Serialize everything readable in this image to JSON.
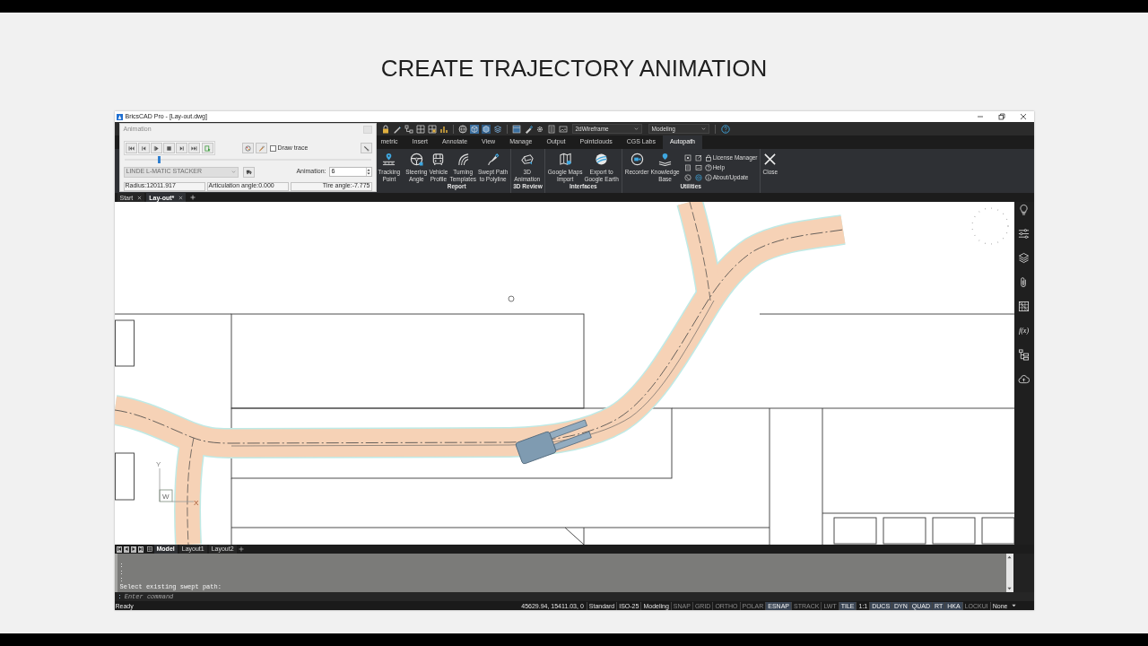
{
  "video_title": "CREATE TRAJECTORY ANIMATION",
  "window": {
    "title": "BricsCAD Pro - [Lay-out.dwg]"
  },
  "quick_access": {
    "visual_style": "2dWireframe",
    "workspace": "Modeling"
  },
  "ribbon_tabs": [
    {
      "label": "metric",
      "selected": false
    },
    {
      "label": "Insert",
      "selected": false
    },
    {
      "label": "Annotate",
      "selected": false
    },
    {
      "label": "View",
      "selected": false
    },
    {
      "label": "Manage",
      "selected": false
    },
    {
      "label": "Output",
      "selected": false
    },
    {
      "label": "Pointclouds",
      "selected": false
    },
    {
      "label": "CGS Labs",
      "selected": false
    },
    {
      "label": "Autopath",
      "selected": true
    }
  ],
  "ribbon": {
    "groups": [
      {
        "buttons": [
          {
            "label": "Tracking\nPoint"
          }
        ]
      },
      {
        "title": "Report",
        "buttons": [
          {
            "label": "Steering\nAngle"
          },
          {
            "label": "Vehicle\nProfile"
          },
          {
            "label": "Turning\nTemplates"
          },
          {
            "label": "Swept Path\nto Polyline"
          }
        ]
      },
      {
        "title": "3D Review",
        "buttons": [
          {
            "label": "3D\nAnimation"
          }
        ]
      },
      {
        "title": "Interfaces",
        "buttons": [
          {
            "label": "Google Maps\nImport"
          },
          {
            "label": "Export to\nGoogle Earth"
          }
        ]
      },
      {
        "title": "Utilities",
        "buttons": [
          {
            "label": "Recorder"
          },
          {
            "label": "Knowledge\nBase"
          }
        ],
        "links": [
          "License Manager",
          "Help",
          "About/Update"
        ]
      },
      {
        "buttons": [
          {
            "label": "Close"
          }
        ]
      }
    ]
  },
  "animation_panel": {
    "title": "Animation",
    "draw_trace": {
      "label": "Draw trace",
      "checked": false
    },
    "slider": {
      "level": 0.14
    },
    "vehicle": {
      "value": "LINDE L-MATIC STACKER",
      "disabled": true
    },
    "animation_count": {
      "label": "Animation:",
      "value": "6"
    },
    "readouts": [
      "Radius:12011.917",
      "Articulation angle:0.000",
      "Tire angle:-7.775"
    ]
  },
  "document_tabs": [
    {
      "label": "Start",
      "selected": false
    },
    {
      "label": "Lay-out*",
      "selected": true
    }
  ],
  "drawing": {
    "ucs_icon": {
      "y_axis": "Y",
      "origin": "W",
      "x_axis": "X"
    }
  },
  "sidebar": {
    "formula_label": "f(x)"
  },
  "layout_tabs": [
    {
      "label": "Model",
      "selected": true
    },
    {
      "label": "Layout1",
      "selected": false
    },
    {
      "label": "Layout2",
      "selected": false
    }
  ],
  "command_line": {
    "history": [
      ":",
      ":",
      ":",
      "Select existing swept path:"
    ],
    "prompt": ":",
    "placeholder": "Enter command"
  },
  "status_bar": {
    "state": "Ready",
    "coordinates": "45629.94, 15411.03, 0",
    "items": [
      {
        "label": "Standard",
        "kind": "text"
      },
      {
        "label": "ISO-25",
        "kind": "text"
      },
      {
        "label": "Modeling",
        "kind": "text"
      },
      {
        "label": "SNAP",
        "kind": "toggle",
        "on": false
      },
      {
        "label": "GRID",
        "kind": "toggle",
        "on": false
      },
      {
        "label": "ORTHO",
        "kind": "toggle",
        "on": false
      },
      {
        "label": "POLAR",
        "kind": "toggle",
        "on": false
      },
      {
        "label": "ESNAP",
        "kind": "toggle",
        "on": true
      },
      {
        "label": "STRACK",
        "kind": "toggle",
        "on": false
      },
      {
        "label": "LWT",
        "kind": "toggle",
        "on": false
      },
      {
        "label": "TILE",
        "kind": "toggle",
        "on": true
      },
      {
        "label": "1:1",
        "kind": "text"
      },
      {
        "label": "DUCS",
        "kind": "toggle",
        "on": true
      },
      {
        "label": "DYN",
        "kind": "toggle",
        "on": true
      },
      {
        "label": "QUAD",
        "kind": "toggle",
        "on": true
      },
      {
        "label": "RT",
        "kind": "toggle",
        "on": true
      },
      {
        "label": "HKA",
        "kind": "toggle",
        "on": true
      },
      {
        "label": "LOCKUI",
        "kind": "toggle",
        "on": false
      },
      {
        "label": "None",
        "kind": "text"
      }
    ]
  }
}
